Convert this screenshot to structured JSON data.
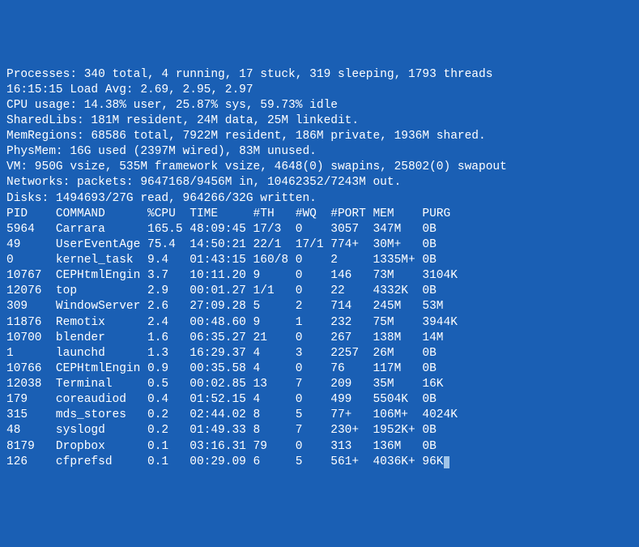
{
  "summary": {
    "processes": "Processes: 340 total, 4 running, 17 stuck, 319 sleeping, 1793 threads",
    "time_load": "16:15:15 Load Avg: 2.69, 2.95, 2.97",
    "cpu": "CPU usage: 14.38% user, 25.87% sys, 59.73% idle",
    "sharedlibs": "SharedLibs: 181M resident, 24M data, 25M linkedit.",
    "memregions": "MemRegions: 68586 total, 7922M resident, 186M private, 1936M shared.",
    "physmem": "PhysMem: 16G used (2397M wired), 83M unused.",
    "vm": "VM: 950G vsize, 535M framework vsize, 4648(0) swapins, 25802(0) swapout",
    "networks": "Networks: packets: 9647168/9456M in, 10462352/7243M out.",
    "disks": "Disks: 1494693/27G read, 964266/32G written."
  },
  "columns": {
    "pid": "PID",
    "command": "COMMAND",
    "cpu": "%CPU",
    "time": "TIME",
    "th": "#TH",
    "wq": "#WQ",
    "port": "#PORT",
    "mem": "MEM",
    "purg": "PURG"
  },
  "rows": [
    {
      "pid": "5964",
      "command": "Carrara",
      "cpu": "165.5",
      "time": "48:09:45",
      "th": "17/3",
      "wq": "0",
      "port": "3057",
      "mem": "347M",
      "purg": "0B"
    },
    {
      "pid": "49",
      "command": "UserEventAge",
      "cpu": "75.4",
      "time": "14:50:21",
      "th": "22/1",
      "wq": "17/1",
      "port": "774+",
      "mem": "30M+",
      "purg": "0B"
    },
    {
      "pid": "0",
      "command": "kernel_task",
      "cpu": "9.4",
      "time": "01:43:15",
      "th": "160/8",
      "wq": "0",
      "port": "2",
      "mem": "1335M+",
      "purg": "0B"
    },
    {
      "pid": "10767",
      "command": "CEPHtmlEngin",
      "cpu": "3.7",
      "time": "10:11.20",
      "th": "9",
      "wq": "0",
      "port": "146",
      "mem": "73M",
      "purg": "3104K"
    },
    {
      "pid": "12076",
      "command": "top",
      "cpu": "2.9",
      "time": "00:01.27",
      "th": "1/1",
      "wq": "0",
      "port": "22",
      "mem": "4332K",
      "purg": "0B"
    },
    {
      "pid": "309",
      "command": "WindowServer",
      "cpu": "2.6",
      "time": "27:09.28",
      "th": "5",
      "wq": "2",
      "port": "714",
      "mem": "245M",
      "purg": "53M"
    },
    {
      "pid": "11876",
      "command": "Remotix",
      "cpu": "2.4",
      "time": "00:48.60",
      "th": "9",
      "wq": "1",
      "port": "232",
      "mem": "75M",
      "purg": "3944K"
    },
    {
      "pid": "10700",
      "command": "blender",
      "cpu": "1.6",
      "time": "06:35.27",
      "th": "21",
      "wq": "0",
      "port": "267",
      "mem": "138M",
      "purg": "14M"
    },
    {
      "pid": "1",
      "command": "launchd",
      "cpu": "1.3",
      "time": "16:29.37",
      "th": "4",
      "wq": "3",
      "port": "2257",
      "mem": "26M",
      "purg": "0B"
    },
    {
      "pid": "10766",
      "command": "CEPHtmlEngin",
      "cpu": "0.9",
      "time": "00:35.58",
      "th": "4",
      "wq": "0",
      "port": "76",
      "mem": "117M",
      "purg": "0B"
    },
    {
      "pid": "12038",
      "command": "Terminal",
      "cpu": "0.5",
      "time": "00:02.85",
      "th": "13",
      "wq": "7",
      "port": "209",
      "mem": "35M",
      "purg": "16K"
    },
    {
      "pid": "179",
      "command": "coreaudiod",
      "cpu": "0.4",
      "time": "01:52.15",
      "th": "4",
      "wq": "0",
      "port": "499",
      "mem": "5504K",
      "purg": "0B"
    },
    {
      "pid": "315",
      "command": "mds_stores",
      "cpu": "0.2",
      "time": "02:44.02",
      "th": "8",
      "wq": "5",
      "port": "77+",
      "mem": "106M+",
      "purg": "4024K"
    },
    {
      "pid": "48",
      "command": "syslogd",
      "cpu": "0.2",
      "time": "01:49.33",
      "th": "8",
      "wq": "7",
      "port": "230+",
      "mem": "1952K+",
      "purg": "0B"
    },
    {
      "pid": "8179",
      "command": "Dropbox",
      "cpu": "0.1",
      "time": "03:16.31",
      "th": "79",
      "wq": "0",
      "port": "313",
      "mem": "136M",
      "purg": "0B"
    },
    {
      "pid": "126",
      "command": "cfprefsd",
      "cpu": "0.1",
      "time": "00:29.09",
      "th": "6",
      "wq": "5",
      "port": "561+",
      "mem": "4036K+",
      "purg": "96K"
    }
  ],
  "widths": {
    "pid": 7,
    "command": 13,
    "cpu": 6,
    "time": 9,
    "th": 6,
    "wq": 5,
    "port": 6,
    "mem": 7,
    "purg": 6
  }
}
